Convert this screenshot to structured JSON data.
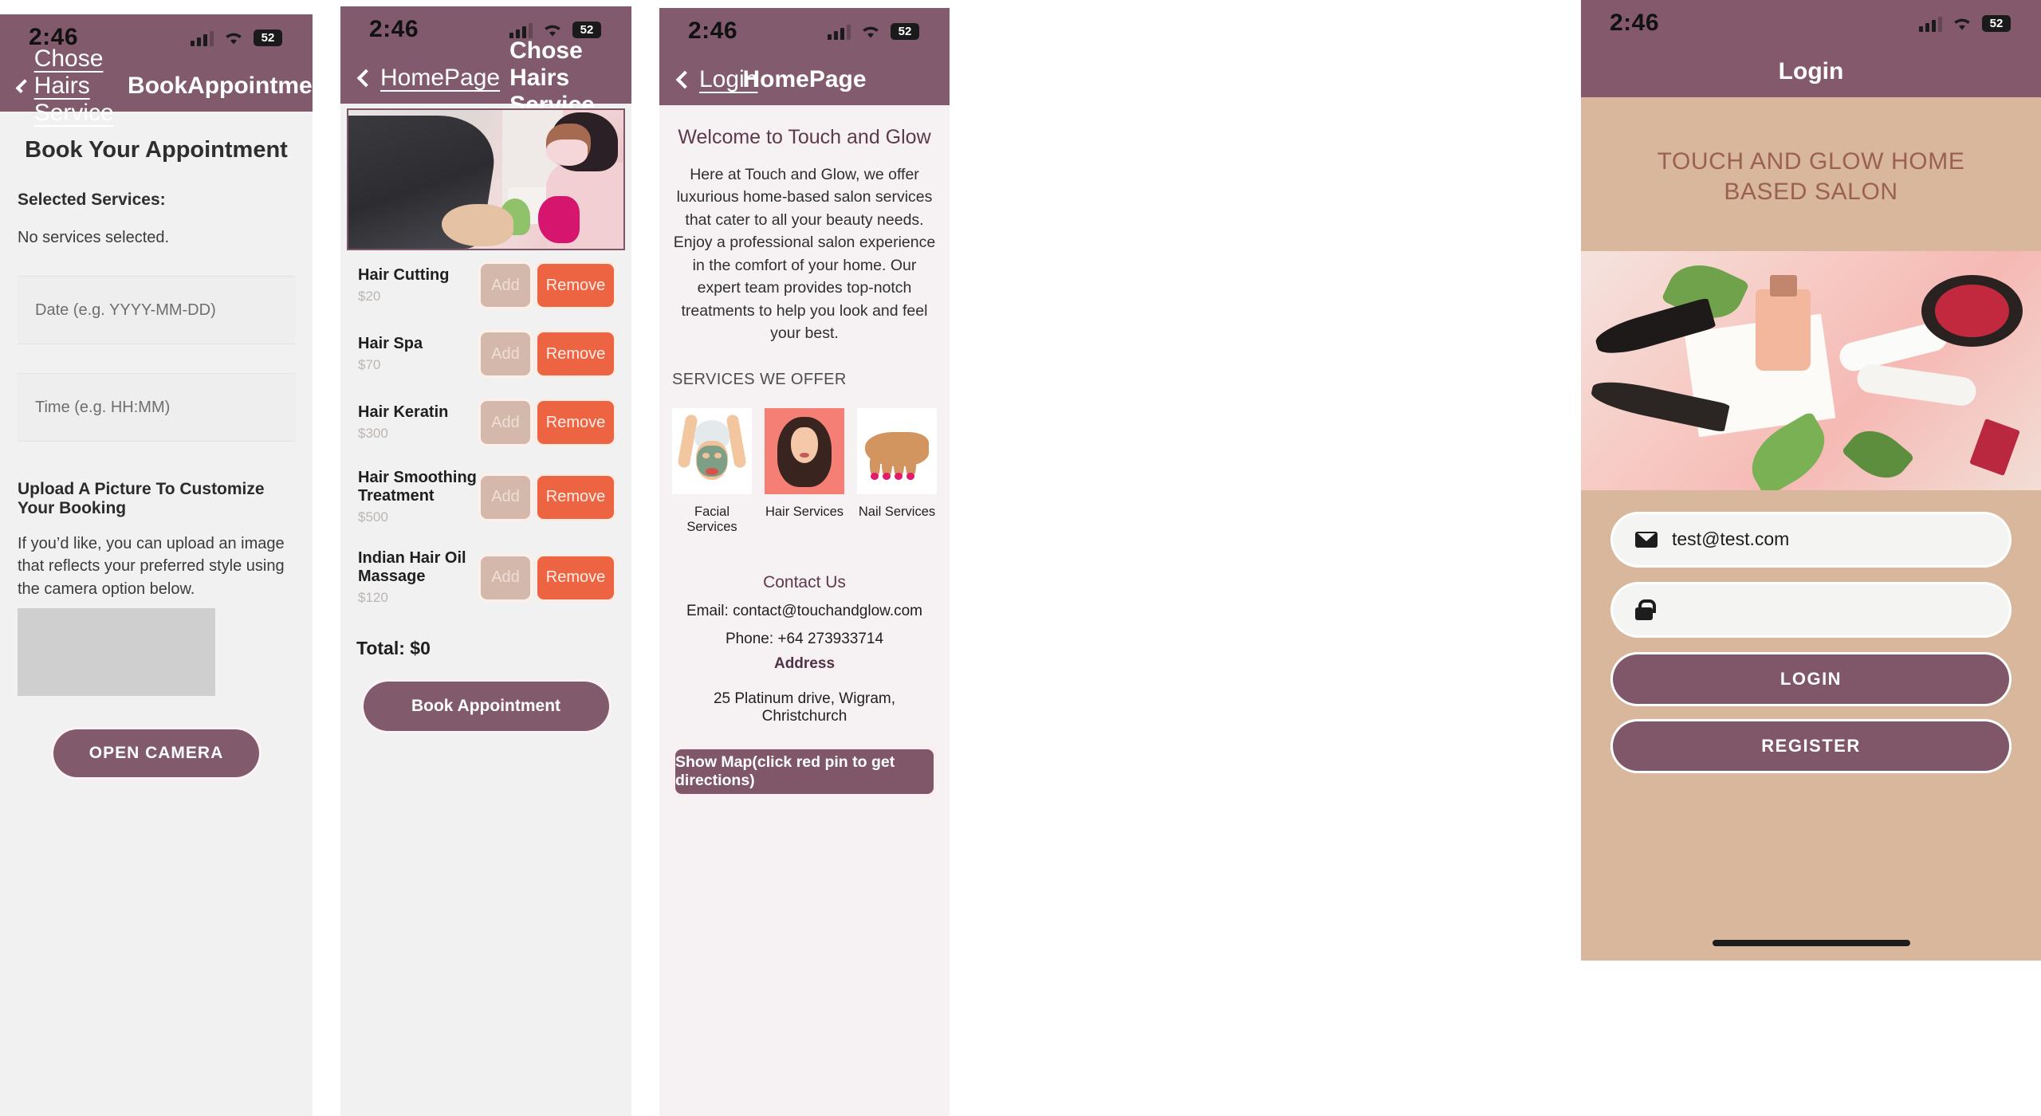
{
  "status_bar": {
    "time": "2:46",
    "battery": "52",
    "signal_icon": "signal-bars-icon",
    "wifi_icon": "wifi-icon",
    "battery_icon": "battery-icon"
  },
  "theme": {
    "primary": "#815a6c",
    "accent_orange": "#ec6442",
    "accent_tan": "#d3b8ab",
    "panel_bg": "#f1f1f1",
    "login_bg": "#d9b79d"
  },
  "panel1": {
    "nav": {
      "back_label": "Chose Hairs Service",
      "title": "BookAppointment",
      "back_icon": "chevron-left-icon"
    },
    "heading": "Book Your Appointment",
    "selected_services_label": "Selected Services:",
    "selected_services_value": "No services selected.",
    "date_placeholder": "Date (e.g. YYYY-MM-DD)",
    "time_placeholder": "Time (e.g. HH:MM)",
    "upload_heading": "Upload A Picture To Customize Your Booking",
    "upload_body": "If you’d like, you can upload an image that reflects your preferred style using the camera option below.",
    "camera_button": "OPEN CAMERA"
  },
  "panel2": {
    "nav": {
      "back_label": "HomePage",
      "title": "Chose Hairs Service",
      "back_icon": "chevron-left-icon"
    },
    "hero_image_alt": "pedicure-nail-technician-photo",
    "add_label": "Add",
    "remove_label": "Remove",
    "services": [
      {
        "name": "Hair Cutting",
        "price": "$20"
      },
      {
        "name": "Hair Spa",
        "price": "$70"
      },
      {
        "name": "Hair Keratin",
        "price": "$300"
      },
      {
        "name": "Hair Smoothing Treatment",
        "price": "$500"
      },
      {
        "name": "Indian Hair Oil Massage",
        "price": "$120"
      }
    ],
    "total": "Total: $0",
    "book_button": "Book Appointment"
  },
  "panel3": {
    "nav": {
      "back_label": "Login",
      "title": "HomePage",
      "back_icon": "chevron-left-icon"
    },
    "welcome_heading": "Welcome to Touch and Glow",
    "intro": "Here at Touch and Glow, we offer luxurious home-based salon services that cater to all your beauty needs. Enjoy a professional salon experience in the comfort of your home. Our expert team provides top-notch treatments to help you look and feel your best.",
    "services_heading": "SERVICES WE OFFER",
    "service_cards": [
      {
        "label": "Facial Services",
        "icon": "facial-mask-icon"
      },
      {
        "label": "Hair Services",
        "icon": "long-hair-woman-icon"
      },
      {
        "label": "Nail Services",
        "icon": "manicured-hand-icon"
      }
    ],
    "contact_heading": "Contact Us",
    "email_line": "Email: contact@touchandglow.com",
    "phone_line": "Phone: +64 273933714",
    "address_heading": "Address",
    "address_line": "25 Platinum drive, Wigram, Christchurch",
    "map_button": "Show Map(click red pin to get directions)"
  },
  "panel4": {
    "nav": {
      "title": "Login"
    },
    "brand": "TOUCH AND GLOW HOME BASED SALON",
    "hero_image_alt": "beauty-products-flatlay-photo",
    "email_value": "test@test.com",
    "email_icon": "envelope-icon",
    "password_value": "",
    "password_icon": "lock-icon",
    "login_button": "LOGIN",
    "register_button": "REGISTER"
  }
}
